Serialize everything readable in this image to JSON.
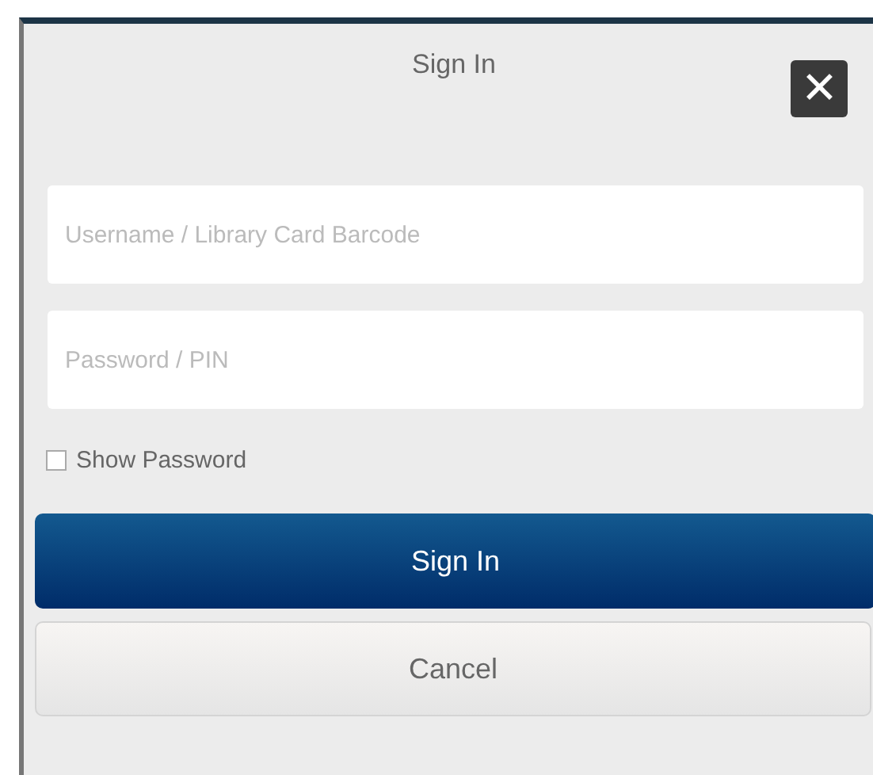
{
  "dialog": {
    "title": "Sign In",
    "close_label": "✕"
  },
  "fields": [
    {
      "placeholder": "Username / Library Card Barcode"
    },
    {
      "placeholder": "Password / PIN"
    }
  ],
  "show_password": {
    "label": "Show Password",
    "checked": false
  },
  "buttons": [
    {
      "label": "Sign In",
      "kind": "primary"
    },
    {
      "label": "Cancel",
      "kind": "secondary"
    }
  ]
}
